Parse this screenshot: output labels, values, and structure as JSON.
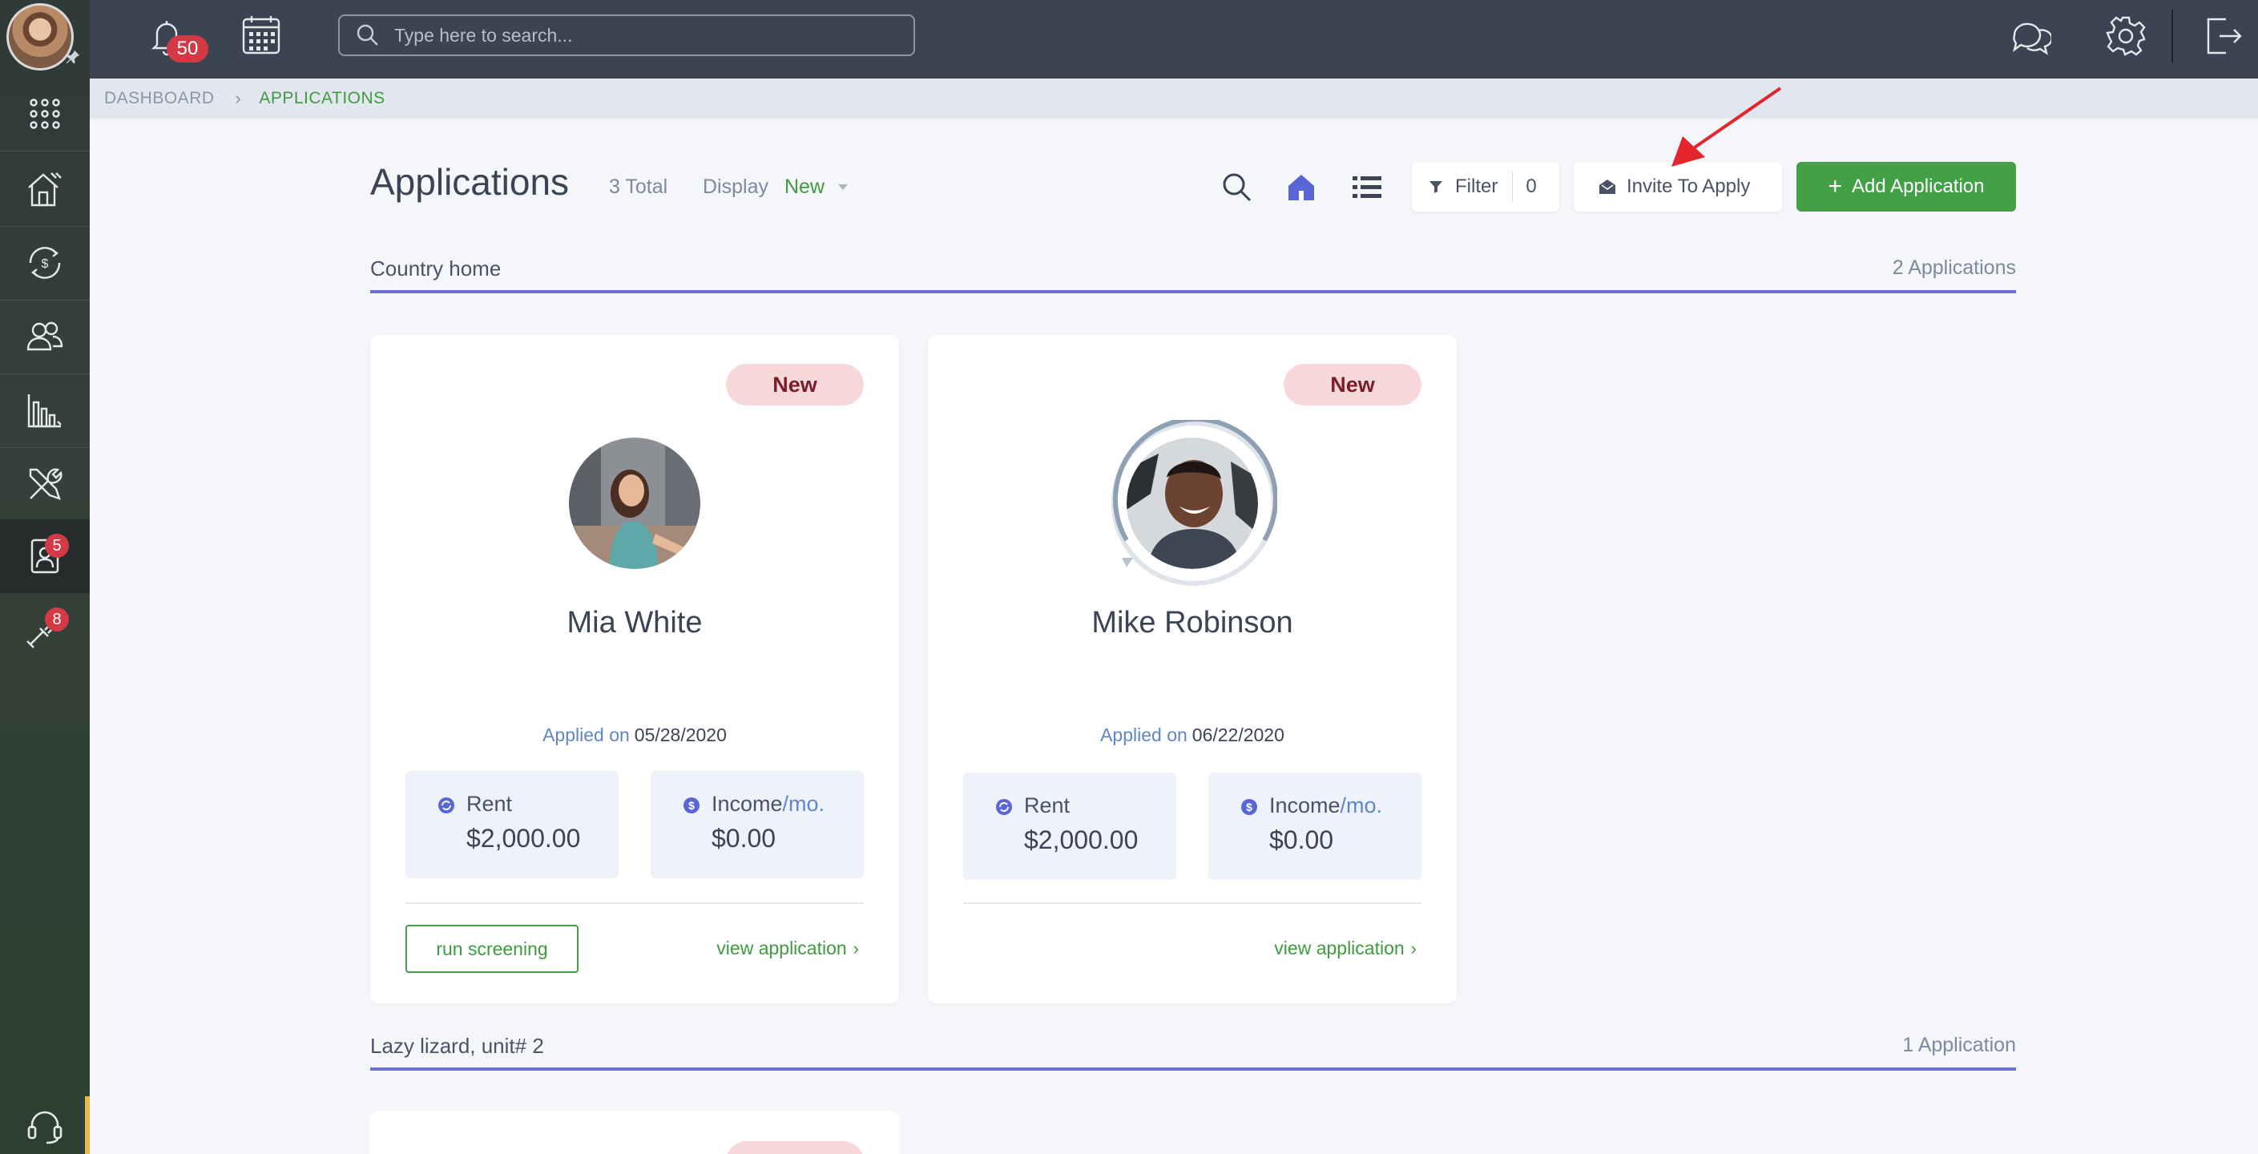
{
  "topbar": {
    "notification_count": "50",
    "search_placeholder": "Type here to search..."
  },
  "sidebar": {
    "items": [
      {
        "icon": "apps-grid-icon",
        "badge": ""
      },
      {
        "icon": "property-house-icon",
        "badge": ""
      },
      {
        "icon": "payments-cycle-icon",
        "badge": ""
      },
      {
        "icon": "people-icon",
        "badge": ""
      },
      {
        "icon": "reports-chart-icon",
        "badge": ""
      },
      {
        "icon": "maintenance-tools-icon",
        "badge": ""
      },
      {
        "icon": "applications-contact-icon",
        "badge": "5"
      },
      {
        "icon": "marketing-tools-icon",
        "badge": "8"
      }
    ],
    "support_icon": "headset-icon"
  },
  "breadcrumb": {
    "home": "DASHBOARD",
    "current": "APPLICATIONS"
  },
  "header": {
    "title": "Applications",
    "total": "3 Total",
    "display_label": "Display",
    "display_value": "New",
    "filter_label": "Filter",
    "filter_count": "0",
    "invite_label": "Invite To Apply",
    "add_label": "Add Application"
  },
  "groups": [
    {
      "name": "Country home",
      "count": "2 Applications",
      "cards": [
        {
          "status": "New",
          "name": "Mia White",
          "applied_label": "Applied on",
          "applied_date": "05/28/2020",
          "rent_label": "Rent",
          "rent_value": "$2,000.00",
          "income_label": "Income",
          "income_unit": "/mo.",
          "income_value": "$0.00",
          "screening_label": "run screening",
          "view_label": "view application"
        },
        {
          "status": "New",
          "name": "Mike Robinson",
          "applied_label": "Applied on",
          "applied_date": "06/22/2020",
          "rent_label": "Rent",
          "rent_value": "$2,000.00",
          "income_label": "Income",
          "income_unit": "/mo.",
          "income_value": "$0.00",
          "view_label": "view application"
        }
      ]
    },
    {
      "name": "Lazy lizard, unit# 2",
      "count": "1 Application"
    }
  ],
  "colors": {
    "accent_green": "#43a047",
    "group_line": "#6b72d6",
    "badge_red": "#d33a45",
    "new_badge_bg": "#f6d8da"
  }
}
